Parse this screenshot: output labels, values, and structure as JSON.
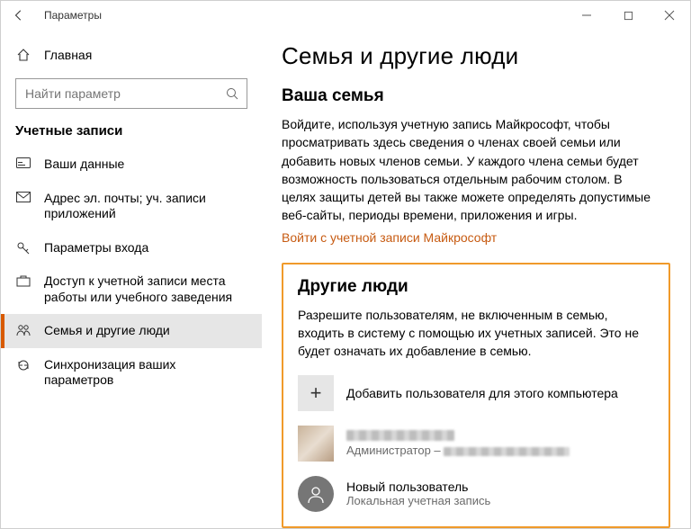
{
  "window": {
    "title": "Параметры"
  },
  "sidebar": {
    "home": "Главная",
    "search_placeholder": "Найти параметр",
    "section": "Учетные записи",
    "items": [
      {
        "label": "Ваши данные"
      },
      {
        "label": "Адрес эл. почты; уч. записи приложений"
      },
      {
        "label": "Параметры входа"
      },
      {
        "label": "Доступ к учетной записи места работы или учебного заведения"
      },
      {
        "label": "Семья и другие люди"
      },
      {
        "label": "Синхронизация ваших параметров"
      }
    ]
  },
  "main": {
    "heading": "Семья и другие люди",
    "family": {
      "title": "Ваша семья",
      "text": "Войдите, используя учетную запись Майкрософт, чтобы просматривать здесь сведения о членах своей семьи или добавить новых членов семьи. У каждого члена семьи будет возможность пользоваться отдельным рабочим столом. В целях защиты детей вы также можете определять допустимые веб-сайты, периоды времени, приложения и игры.",
      "link": "Войти с учетной записи Майкрософт"
    },
    "others": {
      "title": "Другие люди",
      "text": "Разрешите пользователям, не включенным в семью, входить в систему с помощью их учетных записей. Это не будет означать их добавление в семью.",
      "add_label": "Добавить пользователя для этого компьютера",
      "user1": {
        "name": "",
        "sub_prefix": "Администратор – "
      },
      "user2": {
        "name": "Новый пользователь",
        "sub": "Локальная учетная запись"
      }
    }
  }
}
